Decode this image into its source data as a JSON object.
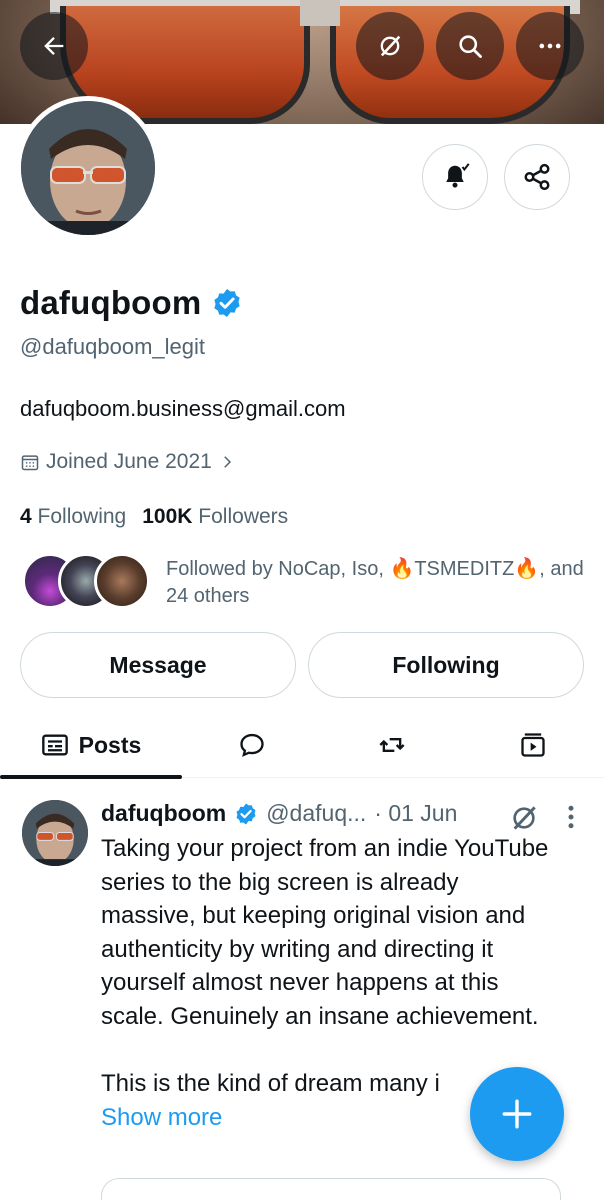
{
  "header": {
    "back_icon": "arrow-left-icon",
    "grok_icon": "grok-icon",
    "search_icon": "search-icon",
    "more_icon": "more-horizontal-icon"
  },
  "profile": {
    "name": "dafuqboom",
    "handle": "@dafuqboom_legit",
    "bio": "dafuqboom.business@gmail.com",
    "joined": "Joined June 2021",
    "following_count": "4",
    "following_label": "Following",
    "followers_count": "100K",
    "followers_label": "Followers",
    "followed_by": "Followed by NoCap, Iso, 🔥TSMEDITZ🔥, and 24 others",
    "notifications_icon": "bell-subscribed-icon",
    "share_icon": "share-icon"
  },
  "actions": {
    "message_label": "Message",
    "following_label": "Following"
  },
  "tabs": [
    {
      "label": "Posts",
      "icon": "posts-icon",
      "active": true
    },
    {
      "label": "",
      "icon": "reply-bubble-icon",
      "active": false
    },
    {
      "label": "",
      "icon": "repost-icon",
      "active": false
    },
    {
      "label": "",
      "icon": "media-icon",
      "active": false
    }
  ],
  "post": {
    "author": "dafuqboom",
    "handle": "@dafuq...",
    "date": "· 01 Jun",
    "paragraph1": "Taking your project from an indie YouTube series to the big screen is already massive, but keeping original vision and authenticity by writing and directing it yourself almost never happens at this scale. Genuinely an insane achievement.",
    "paragraph2": "This is the kind of dream many i",
    "show_more": "Show more"
  },
  "colors": {
    "accent": "#1d9bf0",
    "text": "#0f1419",
    "secondary_text": "#536471",
    "border": "#cfd9de"
  }
}
